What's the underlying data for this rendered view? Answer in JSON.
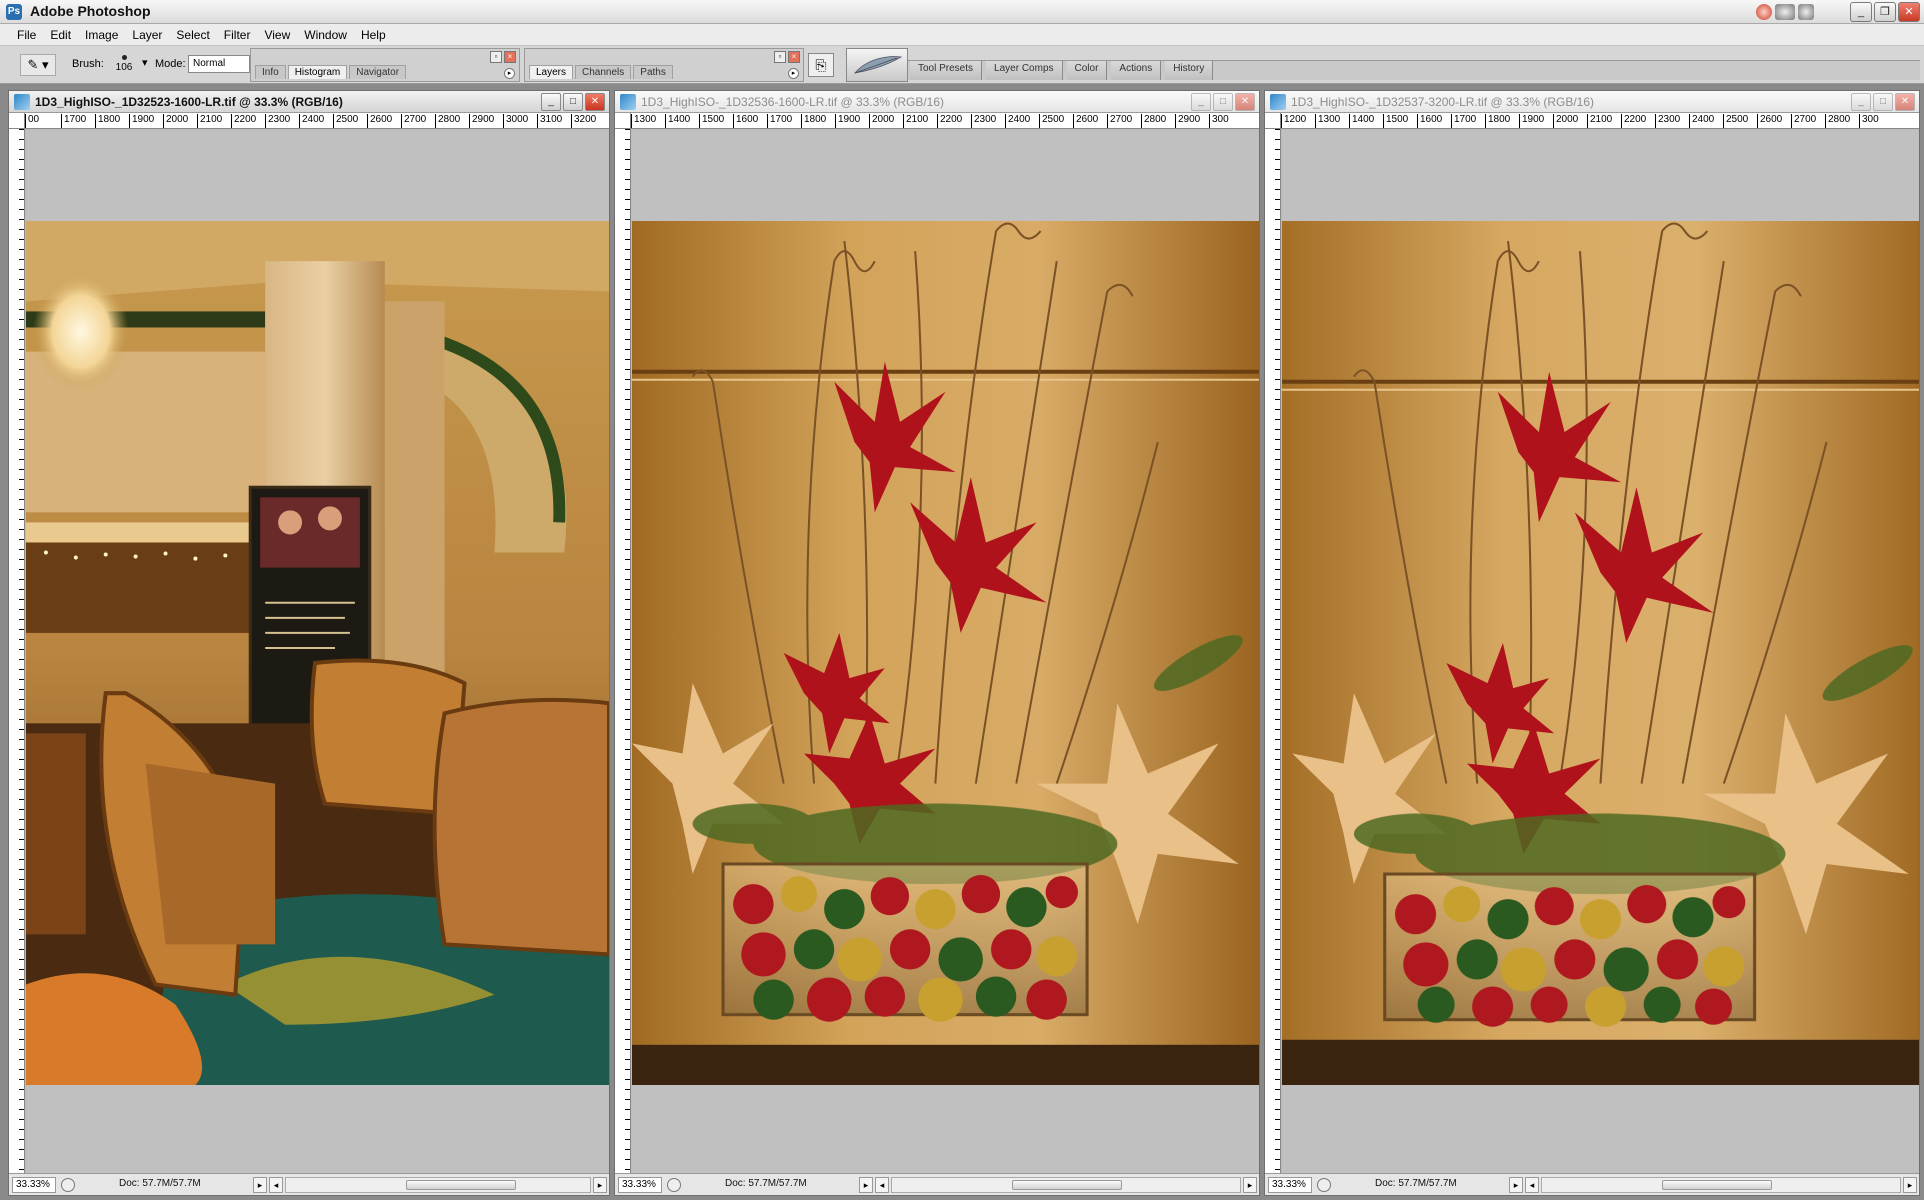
{
  "app": {
    "title": "Adobe Photoshop",
    "icon": "photoshop-icon"
  },
  "menu": [
    "File",
    "Edit",
    "Image",
    "Layer",
    "Select",
    "Filter",
    "View",
    "Window",
    "Help"
  ],
  "options": {
    "brush_label": "Brush:",
    "brush_size": "106",
    "mode_label": "Mode:",
    "mode_value": "Normal"
  },
  "palettes": {
    "well1_tabs": [
      "Info",
      "Histogram",
      "Navigator"
    ],
    "well1_active": "Histogram",
    "well2_tabs": [
      "Layers",
      "Channels",
      "Paths"
    ],
    "well2_active": "Layers",
    "dock_tabs": [
      "Tool Presets",
      "Layer Comps",
      "Color",
      "Actions",
      "History"
    ]
  },
  "documents": [
    {
      "title": "1D3_HighISO-_1D32523-1600-LR.tif @ 33.3% (RGB/16)",
      "active": true,
      "ruler_ticks": [
        "00",
        "1700",
        "1800",
        "1900",
        "2000",
        "2100",
        "2200",
        "2300",
        "2400",
        "2500",
        "2600",
        "2700",
        "2800",
        "2900",
        "3000",
        "3100",
        "3200"
      ],
      "zoom": "33.33%",
      "doc_size": "Doc: 57.7M/57.7M"
    },
    {
      "title": "1D3_HighISO-_1D32536-1600-LR.tif @ 33.3% (RGB/16)",
      "active": false,
      "ruler_ticks": [
        "1300",
        "1400",
        "1500",
        "1600",
        "1700",
        "1800",
        "1900",
        "2000",
        "2100",
        "2200",
        "2300",
        "2400",
        "2500",
        "2600",
        "2700",
        "2800",
        "2900",
        "300"
      ],
      "zoom": "33.33%",
      "doc_size": "Doc: 57.7M/57.7M"
    },
    {
      "title": "1D3_HighISO-_1D32537-3200-LR.tif @ 33.3% (RGB/16)",
      "active": false,
      "ruler_ticks": [
        "1200",
        "1300",
        "1400",
        "1500",
        "1600",
        "1700",
        "1800",
        "1900",
        "2000",
        "2100",
        "2200",
        "2300",
        "2400",
        "2500",
        "2600",
        "2700",
        "2800",
        "300"
      ],
      "zoom": "33.33%",
      "doc_size": "Doc: 57.7M/57.7M"
    }
  ]
}
